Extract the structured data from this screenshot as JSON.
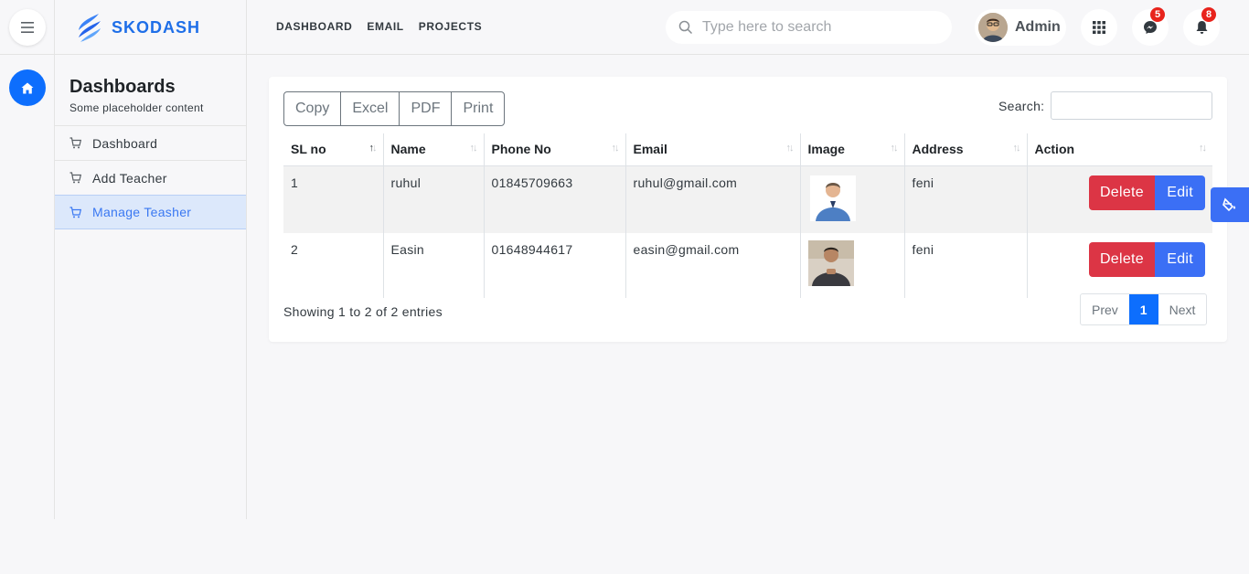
{
  "header": {
    "brand": "SKODASH",
    "nav": [
      "DASHBOARD",
      "EMAIL",
      "PROJECTS"
    ],
    "search_placeholder": "Type here to search",
    "user_name": "Admin",
    "messages_count": "5",
    "notifications_count": "8"
  },
  "sidebar": {
    "title": "Dashboards",
    "subtitle": "Some placeholder content",
    "items": [
      {
        "label": "Dashboard",
        "active": false
      },
      {
        "label": "Add Teacher",
        "active": false
      },
      {
        "label": "Manage Teasher",
        "active": true
      }
    ]
  },
  "toolbar": {
    "buttons": [
      "Copy",
      "Excel",
      "PDF",
      "Print"
    ],
    "search_label": "Search:"
  },
  "table": {
    "columns": [
      "SL no",
      "Name",
      "Phone No",
      "Email",
      "Image",
      "Address",
      "Action"
    ],
    "rows": [
      {
        "sl": "1",
        "name": "ruhul",
        "phone": "01845709663",
        "email": "ruhul@gmail.com",
        "address": "feni"
      },
      {
        "sl": "2",
        "name": "Easin",
        "phone": "01648944617",
        "email": "easin@gmail.com",
        "address": "feni"
      }
    ],
    "delete_label": "Delete",
    "edit_label": "Edit"
  },
  "footer": {
    "info": "Showing 1 to 2 of 2 entries",
    "prev": "Prev",
    "page": "1",
    "next": "Next"
  },
  "icons": {
    "menu": "hamburger-icon",
    "search": "search-icon",
    "apps": "grid-icon",
    "messages": "messenger-icon",
    "notifications": "bell-icon",
    "home": "home-icon",
    "menu_item": "cart-icon",
    "float": "paint-bucket-icon"
  },
  "colors": {
    "primary": "#0d6efd",
    "danger": "#dc3545",
    "edit": "#3b6ff5",
    "badge": "#e8231c"
  }
}
